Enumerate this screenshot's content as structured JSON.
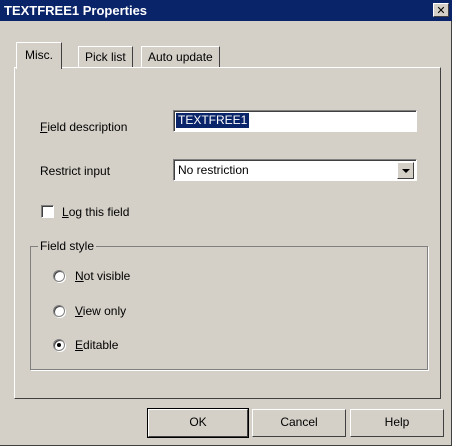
{
  "window": {
    "title": "TEXTFREE1 Properties",
    "close_glyph": "✕"
  },
  "tabs": [
    {
      "label": "Misc."
    },
    {
      "label": "Pick list"
    },
    {
      "label": "Auto update"
    }
  ],
  "fields": {
    "field_description_label": "Field description",
    "field_description_value": "TEXTFREE1",
    "restrict_input_label": "Restrict input",
    "restrict_input_value": "No restriction",
    "log_field_label": "Log this field",
    "log_field_checked": false
  },
  "field_style": {
    "legend": "Field style",
    "options": [
      {
        "label": "Not visible",
        "selected": false
      },
      {
        "label": "View only",
        "selected": false
      },
      {
        "label": "Editable",
        "selected": true
      }
    ]
  },
  "buttons": {
    "ok": "OK",
    "cancel": "Cancel",
    "help": "Help"
  },
  "colors": {
    "titlebar": "#0a246a",
    "face": "#d4d0c8",
    "selection": "#0a246a"
  }
}
